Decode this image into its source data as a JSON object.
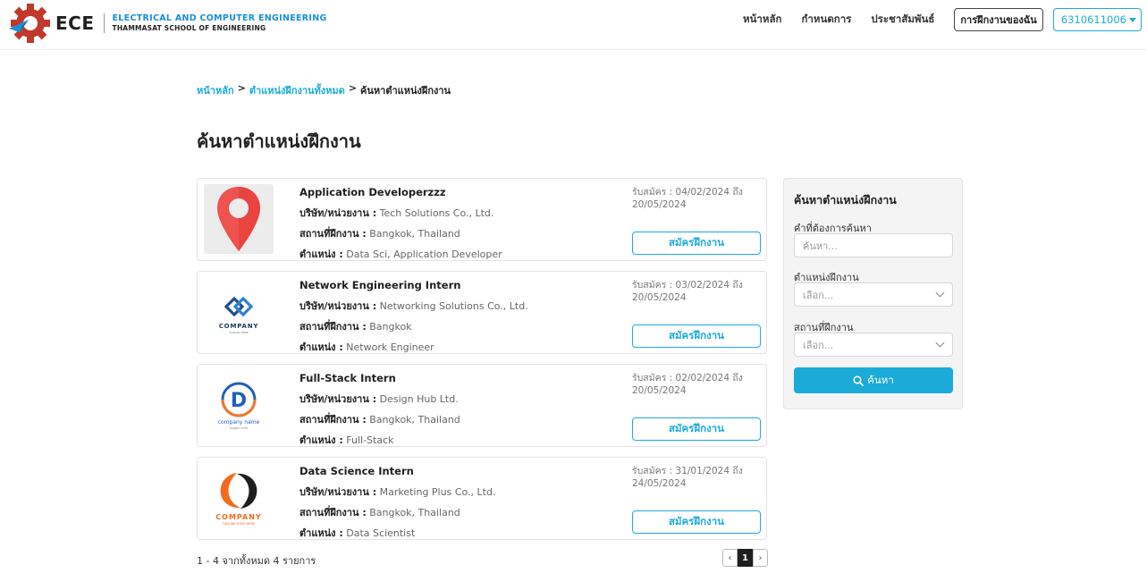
{
  "header": {
    "logo": {
      "abbr": "ECE",
      "line1": "ELECTRICAL AND COMPUTER ENGINEERING",
      "line2": "THAMMASAT SCHOOL OF ENGINEERING",
      "gear_color": "#c0392b"
    },
    "nav": {
      "home": "หน้าหลัก",
      "schedule": "กำหนดการ",
      "news": "ประชาสัมพันธ์",
      "my_internship": "การฝึกงานของฉัน",
      "user_id": "6310611006"
    }
  },
  "breadcrumb": {
    "home": "หน้าหลัก",
    "all_positions": "ตำแหน่งฝึกงานทั้งหมด",
    "separator": ">",
    "current": "ค้นหาตำแหน่งฝึกงาน"
  },
  "page_title": "ค้นหาตำแหน่งฝึกงาน",
  "labels": {
    "company": "บริษัท/หน่วยงาน :",
    "location": "สถานที่ฝึกงาน :",
    "position": "ตำแหน่ง :",
    "apply": "สมัครฝึกงาน"
  },
  "jobs": [
    {
      "title": "Application Developerzzz",
      "company": "Tech Solutions Co., Ltd.",
      "location": "Bangkok, Thailand",
      "position": "Data Sci, Application Developer",
      "date_line1": "รับสมัคร : 04/02/2024 ถึง",
      "date_line2": "20/05/2024",
      "logo_icon": "map-pin-icon"
    },
    {
      "title": "Network Engineering Intern",
      "company": "Networking Solutions Co., Ltd.",
      "location": "Bangkok",
      "position": "Network Engineer",
      "date_line1": "รับสมัคร : 03/02/2024 ถึง",
      "date_line2": "20/05/2024",
      "logo_icon": "company-logo-icon",
      "logo_text": "COMPANY",
      "logo_tagline": "SLOGAN HERE"
    },
    {
      "title": "Full-Stack Intern",
      "company": "Design Hub Ltd.",
      "location": "Bangkok, Thailand",
      "position": "Full-Stack",
      "date_line1": "รับสมัคร : 02/02/2024 ถึง",
      "date_line2": "20/05/2024",
      "logo_icon": "letter-d-logo-icon",
      "logo_letter": "D",
      "logo_text": "company name",
      "logo_tagline": "slogan here"
    },
    {
      "title": "Data Science Intern",
      "company": "Marketing Plus Co., Ltd.",
      "location": "Bangkok, Thailand",
      "position": "Data Scientist",
      "date_line1": "รับสมัคร : 31/01/2024 ถึง",
      "date_line2": "24/05/2024",
      "logo_icon": "ring-logo-icon",
      "logo_text": "COMPANY",
      "logo_tagline": "TAGLINE GOES HERE"
    }
  ],
  "result_count": "1 - 4 จากทั้งหมด 4 รายการ",
  "pagination": {
    "prev": "‹",
    "current": "1",
    "next": "›"
  },
  "search_panel": {
    "title": "ค้นหาตำแหน่งฝึกงาน",
    "keyword_label": "คำที่ต้องการค้นหา",
    "keyword_placeholder": "ค้นหา...",
    "position_label": "ตำแหน่งฝึกงาน",
    "position_placeholder": "เลือก...",
    "location_label": "สถานที่ฝึกงาน",
    "location_placeholder": "เลือก...",
    "search_button": "ค้นหา"
  },
  "colors": {
    "accent": "#1cabd9",
    "pin": "#ef5350"
  }
}
